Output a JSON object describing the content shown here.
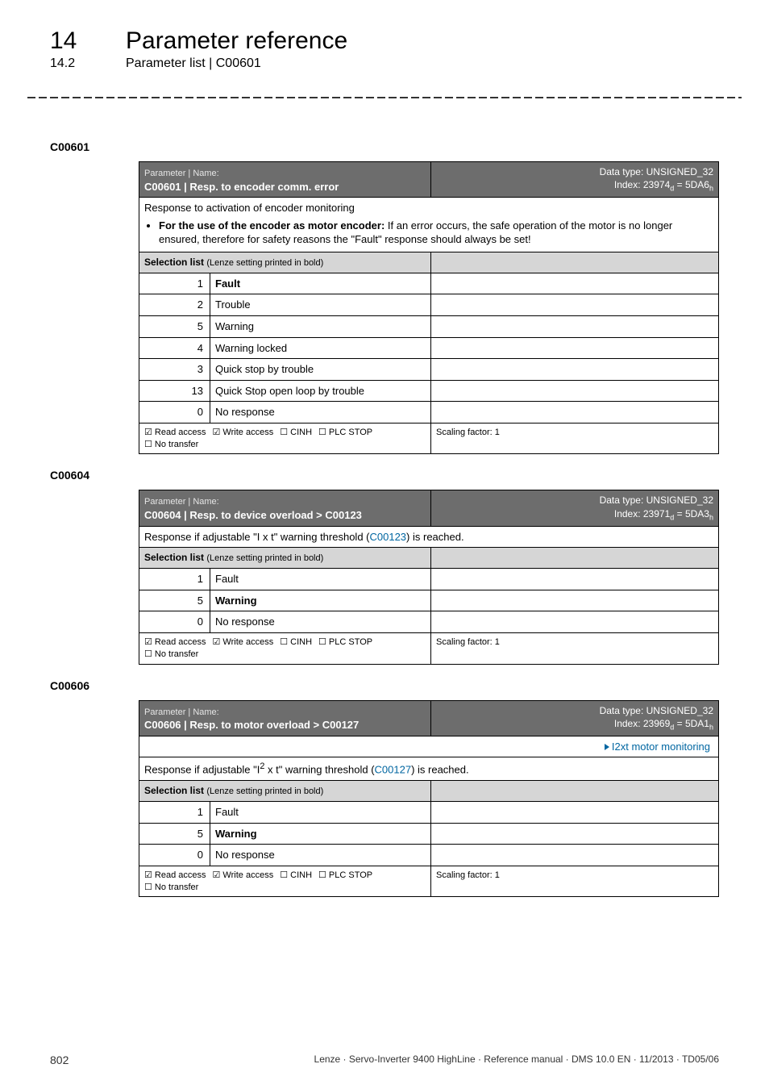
{
  "header": {
    "chapter_number": "14",
    "chapter_title": "Parameter reference",
    "section_number": "14.2",
    "section_title": "Parameter list | C00601"
  },
  "tables": {
    "c00601": {
      "anchor": "C00601",
      "param_label": "Parameter | Name:",
      "param_name": "C00601 | Resp. to encoder comm. error",
      "datatype_line": "Data type: UNSIGNED_32",
      "index_line_prefix": "Index: 23974",
      "index_line_d": "d",
      "index_line_mid": " = 5DA6",
      "index_line_h": "h",
      "desc": "Response to activation of encoder monitoring",
      "bullet_strong": "For the use of the encoder as motor encoder:",
      "bullet_rest": " If an error occurs, the safe operation of the motor is no longer ensured, therefore for safety reasons the \"Fault\" response should always be set!",
      "selection_label": "Selection list ",
      "selection_sub": "(Lenze setting printed in bold)",
      "rows": [
        {
          "k": "1",
          "v": "Fault",
          "bold": true
        },
        {
          "k": "2",
          "v": "Trouble",
          "bold": false
        },
        {
          "k": "5",
          "v": "Warning",
          "bold": false
        },
        {
          "k": "4",
          "v": "Warning locked",
          "bold": false
        },
        {
          "k": "3",
          "v": "Quick stop by trouble",
          "bold": false
        },
        {
          "k": "13",
          "v": "Quick Stop open loop by trouble",
          "bold": false
        },
        {
          "k": "0",
          "v": "No response",
          "bold": false
        }
      ],
      "foot_checks": [
        {
          "sym": "☑",
          "label": "Read access"
        },
        {
          "sym": "☑",
          "label": "Write access"
        },
        {
          "sym": "☐",
          "label": "CINH"
        },
        {
          "sym": "☐",
          "label": "PLC STOP"
        },
        {
          "sym": "☐",
          "label": "No transfer"
        }
      ],
      "scaling": "Scaling factor: 1"
    },
    "c00604": {
      "anchor": "C00604",
      "param_label": "Parameter | Name:",
      "param_name": "C00604 | Resp. to device overload > C00123",
      "datatype_line": "Data type: UNSIGNED_32",
      "index_line_prefix": "Index: 23971",
      "index_line_d": "d",
      "index_line_mid": " = 5DA3",
      "index_line_h": "h",
      "desc_before": "Response if adjustable \"I x t\" warning threshold (",
      "desc_link": "C00123",
      "desc_after": ") is reached.",
      "selection_label": "Selection list ",
      "selection_sub": "(Lenze setting printed in bold)",
      "rows": [
        {
          "k": "1",
          "v": "Fault",
          "bold": false
        },
        {
          "k": "5",
          "v": "Warning",
          "bold": true
        },
        {
          "k": "0",
          "v": "No response",
          "bold": false
        }
      ],
      "foot_checks": [
        {
          "sym": "☑",
          "label": "Read access"
        },
        {
          "sym": "☑",
          "label": "Write access"
        },
        {
          "sym": "☐",
          "label": "CINH"
        },
        {
          "sym": "☐",
          "label": "PLC STOP"
        },
        {
          "sym": "☐",
          "label": "No transfer"
        }
      ],
      "scaling": "Scaling factor: 1"
    },
    "c00606": {
      "anchor": "C00606",
      "param_label": "Parameter | Name:",
      "param_name": "C00606 | Resp. to motor overload > C00127",
      "datatype_line": "Data type: UNSIGNED_32",
      "index_line_prefix": "Index: 23969",
      "index_line_d": "d",
      "index_line_mid": " = 5DA1",
      "index_line_h": "h",
      "top_link": "I2xt motor monitoring",
      "desc_before": "Response if adjustable \"I",
      "desc_sup": "2",
      "desc_mid": " x t\" warning threshold (",
      "desc_link": "C00127",
      "desc_after": ") is reached.",
      "selection_label": "Selection list ",
      "selection_sub": "(Lenze setting printed in bold)",
      "rows": [
        {
          "k": "1",
          "v": "Fault",
          "bold": false
        },
        {
          "k": "5",
          "v": "Warning",
          "bold": true
        },
        {
          "k": "0",
          "v": "No response",
          "bold": false
        }
      ],
      "foot_checks": [
        {
          "sym": "☑",
          "label": "Read access"
        },
        {
          "sym": "☑",
          "label": "Write access"
        },
        {
          "sym": "☐",
          "label": "CINH"
        },
        {
          "sym": "☐",
          "label": "PLC STOP"
        },
        {
          "sym": "☐",
          "label": "No transfer"
        }
      ],
      "scaling": "Scaling factor: 1"
    }
  },
  "footer": {
    "page": "802",
    "doc": "Lenze · Servo-Inverter 9400 HighLine · Reference manual · DMS 10.0 EN · 11/2013 · TD05/06"
  }
}
